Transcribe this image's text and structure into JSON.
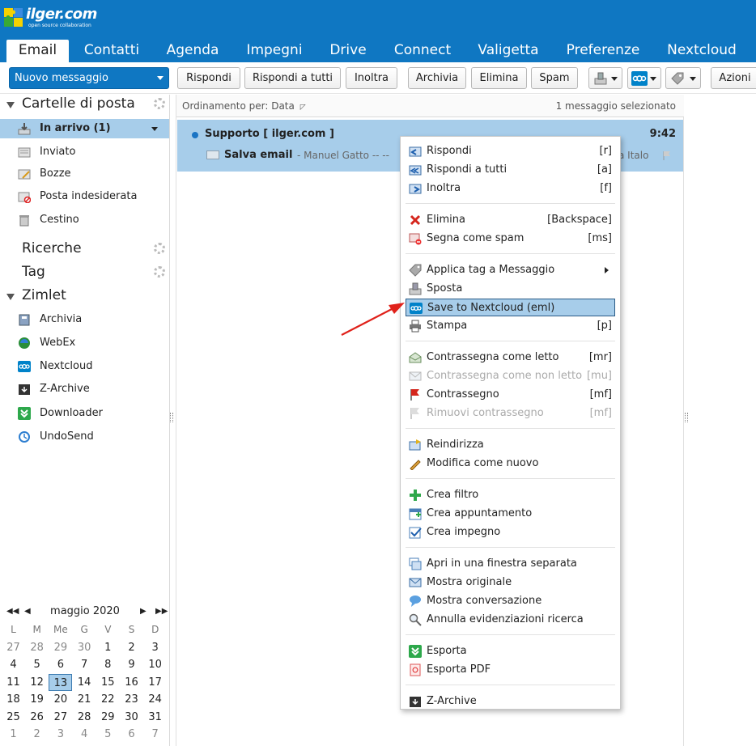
{
  "app": {
    "logo_name": "ilger.com",
    "logo_tagline": "open source collaboration"
  },
  "tabs": [
    {
      "label": "Email",
      "active": true
    },
    {
      "label": "Contatti"
    },
    {
      "label": "Agenda"
    },
    {
      "label": "Impegni"
    },
    {
      "label": "Drive"
    },
    {
      "label": "Connect"
    },
    {
      "label": "Valigetta"
    },
    {
      "label": "Preferenze"
    },
    {
      "label": "Nextcloud"
    }
  ],
  "toolbar": {
    "new_message": "Nuovo messaggio",
    "reply": "Rispondi",
    "reply_all": "Rispondi a tutti",
    "forward": "Inoltra",
    "archive": "Archivia",
    "delete": "Elimina",
    "spam": "Spam",
    "actions": "Azioni"
  },
  "sidebar": {
    "folders_title": "Cartelle di posta",
    "folders": [
      {
        "label": "In arrivo (1)",
        "icon": "inbox-icon",
        "selected": true
      },
      {
        "label": "Inviato",
        "icon": "sent-icon"
      },
      {
        "label": "Bozze",
        "icon": "drafts-icon"
      },
      {
        "label": "Posta indesiderata",
        "icon": "junk-icon"
      },
      {
        "label": "Cestino",
        "icon": "trash-icon"
      }
    ],
    "searches_title": "Ricerche",
    "tags_title": "Tag",
    "zimlets_title": "Zimlet",
    "zimlets": [
      {
        "label": "Archivia",
        "icon": "archive-zimlet-icon"
      },
      {
        "label": "WebEx",
        "icon": "webex-icon"
      },
      {
        "label": "Nextcloud",
        "icon": "nextcloud-icon"
      },
      {
        "label": "Z-Archive",
        "icon": "z-archive-icon"
      },
      {
        "label": "Downloader",
        "icon": "downloader-icon"
      },
      {
        "label": "UndoSend",
        "icon": "undosend-icon"
      }
    ]
  },
  "calendar": {
    "month": "maggio 2020",
    "weekdays": [
      "L",
      "M",
      "Me",
      "G",
      "V",
      "S",
      "D"
    ],
    "weeks": [
      [
        "27",
        "28",
        "29",
        "30",
        "1",
        "2",
        "3"
      ],
      [
        "4",
        "5",
        "6",
        "7",
        "8",
        "9",
        "10"
      ],
      [
        "11",
        "12",
        "13",
        "14",
        "15",
        "16",
        "17"
      ],
      [
        "18",
        "19",
        "20",
        "21",
        "22",
        "23",
        "24"
      ],
      [
        "25",
        "26",
        "27",
        "28",
        "29",
        "30",
        "31"
      ],
      [
        "1",
        "2",
        "3",
        "4",
        "5",
        "6",
        "7"
      ]
    ],
    "today": "13"
  },
  "list": {
    "sort_label": "Ordinamento per: Data",
    "selection_count": "1 messaggio selezionato",
    "message": {
      "conversation": "Supporto [ ilger.com ]",
      "time": "9:42",
      "subject": "Salva email",
      "sender_preview": "- Manuel Gatto -- --",
      "tail": "a Italo"
    }
  },
  "context_menu": {
    "groups": [
      [
        {
          "label": "Rispondi",
          "shortcut": "[r]",
          "icon": "reply-icon"
        },
        {
          "label": "Rispondi a tutti",
          "shortcut": "[a]",
          "icon": "reply-all-icon"
        },
        {
          "label": "Inoltra",
          "shortcut": "[f]",
          "icon": "forward-icon"
        }
      ],
      [
        {
          "label": "Elimina",
          "shortcut": "[Backspace]",
          "icon": "delete-icon"
        },
        {
          "label": "Segna come spam",
          "shortcut": "[ms]",
          "icon": "spam-icon"
        }
      ],
      [
        {
          "label": "Applica tag a Messaggio",
          "shortcut": "",
          "icon": "tag-icon",
          "submenu": true
        },
        {
          "label": "Sposta",
          "shortcut": "",
          "icon": "move-icon"
        },
        {
          "label": "Save to Nextcloud (eml)",
          "shortcut": "",
          "icon": "nextcloud-icon",
          "highlighted": true
        },
        {
          "label": "Stampa",
          "shortcut": "[p]",
          "icon": "print-icon"
        }
      ],
      [
        {
          "label": "Contrassegna come letto",
          "shortcut": "[mr]",
          "icon": "mark-read-icon"
        },
        {
          "label": "Contrassegna come non letto",
          "shortcut": "[mu]",
          "icon": "mark-unread-icon",
          "disabled": true
        },
        {
          "label": "Contrassegno",
          "shortcut": "[mf]",
          "icon": "flag-icon"
        },
        {
          "label": "Rimuovi contrassegno",
          "shortcut": "[mf]",
          "icon": "unflag-icon",
          "disabled": true
        }
      ],
      [
        {
          "label": "Reindirizza",
          "shortcut": "",
          "icon": "redirect-icon"
        },
        {
          "label": "Modifica come nuovo",
          "shortcut": "",
          "icon": "edit-icon"
        }
      ],
      [
        {
          "label": "Crea filtro",
          "shortcut": "",
          "icon": "filter-plus-icon"
        },
        {
          "label": "Crea appuntamento",
          "shortcut": "",
          "icon": "appointment-icon"
        },
        {
          "label": "Crea impegno",
          "shortcut": "",
          "icon": "task-icon"
        }
      ],
      [
        {
          "label": "Apri in una finestra separata",
          "shortcut": "",
          "icon": "new-window-icon"
        },
        {
          "label": "Mostra originale",
          "shortcut": "",
          "icon": "show-original-icon"
        },
        {
          "label": "Mostra conversazione",
          "shortcut": "",
          "icon": "conversation-icon"
        },
        {
          "label": "Annulla evidenziazioni ricerca",
          "shortcut": "",
          "icon": "clear-highlight-icon"
        }
      ],
      [
        {
          "label": "Esporta",
          "shortcut": "",
          "icon": "export-icon"
        },
        {
          "label": "Esporta PDF",
          "shortcut": "",
          "icon": "export-pdf-icon"
        }
      ],
      [
        {
          "label": "Z-Archive",
          "shortcut": "",
          "icon": "z-archive-icon"
        }
      ]
    ]
  },
  "colors": {
    "brand": "#0f77c2",
    "selection": "#a7cdea",
    "arrow": "#e0211a"
  }
}
